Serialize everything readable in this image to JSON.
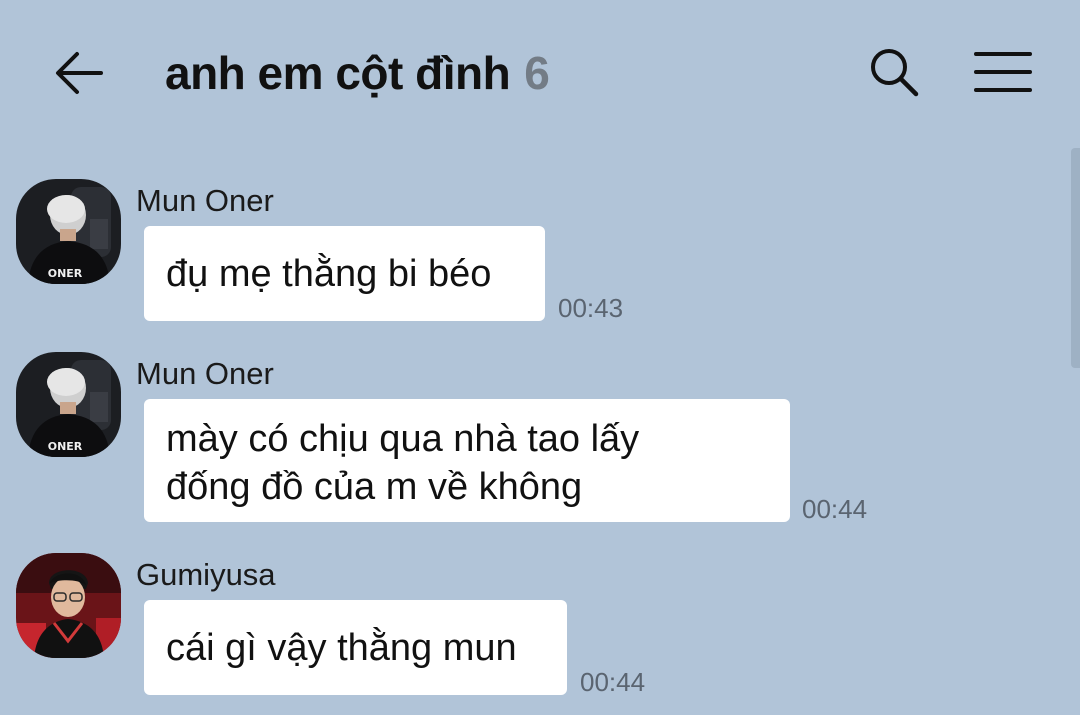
{
  "header": {
    "back_icon": "arrow-left-icon",
    "title": "anh em cột đình",
    "member_count": "6",
    "search_icon": "search-icon",
    "menu_icon": "hamburger-menu-icon"
  },
  "colors": {
    "background": "#b1c4d8",
    "bubble": "#ffffff",
    "member_count": "#737c86",
    "timestamp": "#5a6470"
  },
  "messages": [
    {
      "sender": "Mun Oner",
      "avatar": "oner-avatar",
      "avatar_jersey_text": "ONER",
      "lines": [
        "đụ mẹ thằng bi béo"
      ],
      "time": "00:43"
    },
    {
      "sender": "Mun Oner",
      "avatar": "oner-avatar",
      "avatar_jersey_text": "ONER",
      "lines": [
        "mày có chịu qua nhà tao lấy",
        "đống đồ của m về không"
      ],
      "time": "00:44"
    },
    {
      "sender": "Gumiyusa",
      "avatar": "gumayusi-avatar",
      "lines": [
        "cái gì vậy thằng mun"
      ],
      "time": "00:44"
    }
  ]
}
